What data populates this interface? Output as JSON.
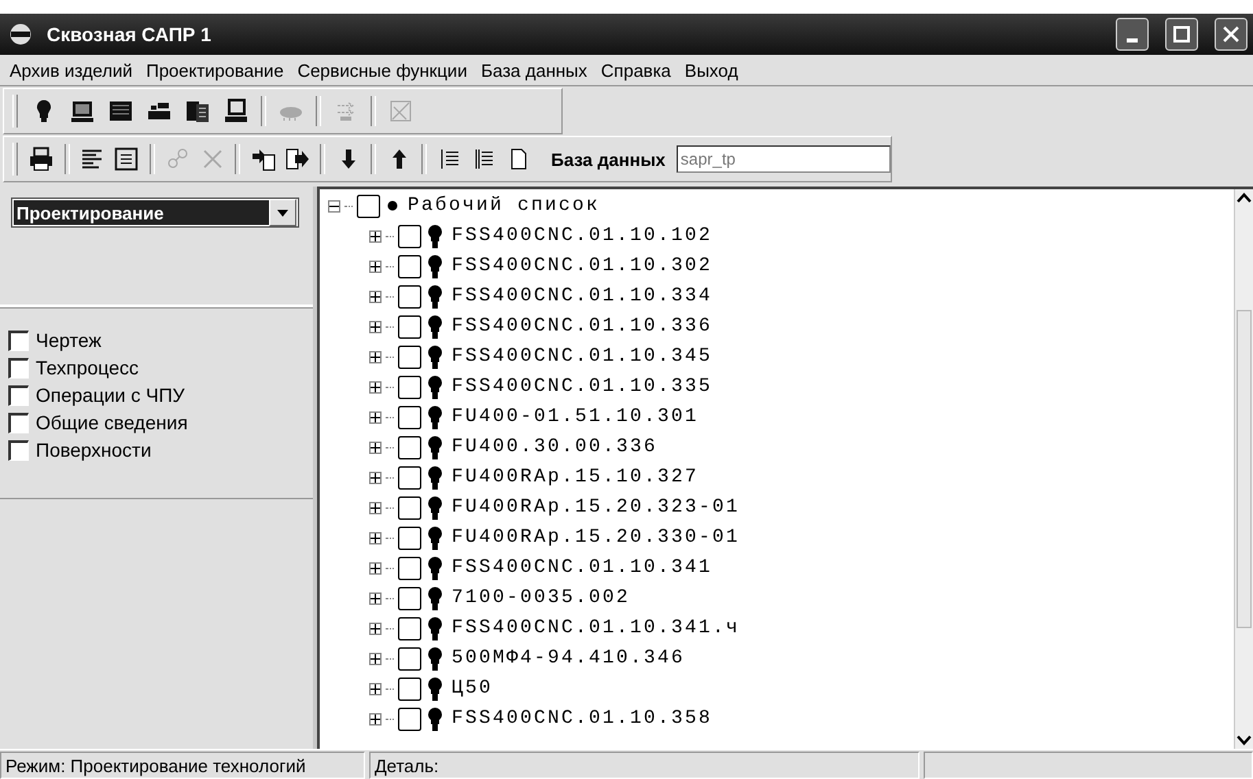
{
  "window": {
    "title": "Сквозная САПР  1"
  },
  "menu": [
    "Архив изделий",
    "Проектирование",
    "Сервисные функции",
    "База данных",
    "Справка",
    "Выход"
  ],
  "toolbar_1": {
    "buttons": [
      {
        "disabled": false
      },
      {
        "disabled": false
      },
      {
        "disabled": false
      },
      {
        "disabled": false
      },
      {
        "disabled": false
      },
      {
        "disabled": false
      },
      {
        "disabled": true
      },
      {
        "disabled": true
      },
      {
        "disabled": true
      }
    ]
  },
  "toolbar_2": {
    "buttons": [
      {
        "disabled": false
      },
      {
        "disabled": false
      },
      {
        "disabled": false
      },
      {
        "disabled": true
      },
      {
        "disabled": true
      },
      {
        "disabled": false
      },
      {
        "disabled": false
      },
      {
        "disabled": false
      },
      {
        "disabled": false
      },
      {
        "disabled": false
      },
      {
        "disabled": false
      },
      {
        "disabled": false
      }
    ],
    "database_label": "База данных",
    "database_field": {
      "value": "sapr_tp"
    }
  },
  "sidebar": {
    "dropdown": {
      "value": "Проектирование"
    },
    "options": [
      {
        "label": "Чертеж",
        "checked": false
      },
      {
        "label": "Техпроцесс",
        "checked": false
      },
      {
        "label": "Операции с ЧПУ",
        "checked": false
      },
      {
        "label": "Общие сведения",
        "checked": false
      },
      {
        "label": "Поверхности",
        "checked": false
      }
    ]
  },
  "tree": {
    "root": {
      "label": "Рабочий список",
      "expanded": true,
      "checked": false,
      "children": [
        {
          "label": "FSS400CNC.01.10.102",
          "expanded": false,
          "checked": false
        },
        {
          "label": "FSS400CNC.01.10.302",
          "expanded": false,
          "checked": false
        },
        {
          "label": "FSS400CNC.01.10.334",
          "expanded": false,
          "checked": false
        },
        {
          "label": "FSS400CNC.01.10.336",
          "expanded": false,
          "checked": false
        },
        {
          "label": "FSS400CNC.01.10.345",
          "expanded": false,
          "checked": false
        },
        {
          "label": "FSS400CNC.01.10.335",
          "expanded": false,
          "checked": false
        },
        {
          "label": "FU400-01.51.10.301",
          "expanded": false,
          "checked": false
        },
        {
          "label": "FU400.30.00.336",
          "expanded": false,
          "checked": false
        },
        {
          "label": "FU400RAp.15.10.327",
          "expanded": false,
          "checked": false
        },
        {
          "label": "FU400RAp.15.20.323-01",
          "expanded": false,
          "checked": false
        },
        {
          "label": "FU400RAp.15.20.330-01",
          "expanded": false,
          "checked": false
        },
        {
          "label": "FSS400CNC.01.10.341",
          "expanded": false,
          "checked": false
        },
        {
          "label": "7100-0035.002",
          "expanded": false,
          "checked": false
        },
        {
          "label": "FSS400CNC.01.10.341.ч",
          "expanded": false,
          "checked": false
        },
        {
          "label": "500МФ4-94.410.346",
          "expanded": false,
          "checked": false
        },
        {
          "label": "Ц50",
          "expanded": false,
          "checked": false
        },
        {
          "label": "FSS400CNC.01.10.358",
          "expanded": false,
          "checked": false
        }
      ]
    }
  },
  "status_bar": [
    "Режим: Проектирование технологий",
    "Деталь:"
  ]
}
